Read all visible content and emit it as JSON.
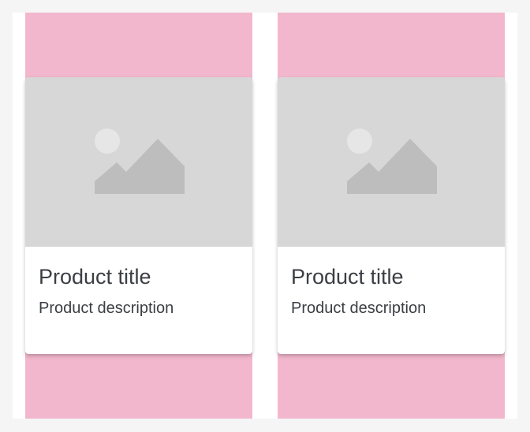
{
  "products": [
    {
      "title": "Product title",
      "description": "Product description",
      "image_icon": "image-placeholder-icon"
    },
    {
      "title": "Product title",
      "description": "Product description",
      "image_icon": "image-placeholder-icon"
    }
  ],
  "colors": {
    "column_background": "#f2b7cc",
    "media_background": "#d7d7d7",
    "placeholder_shape": "#bdbdbd",
    "placeholder_sun": "#e6e6e6",
    "text": "#3b3e44"
  }
}
